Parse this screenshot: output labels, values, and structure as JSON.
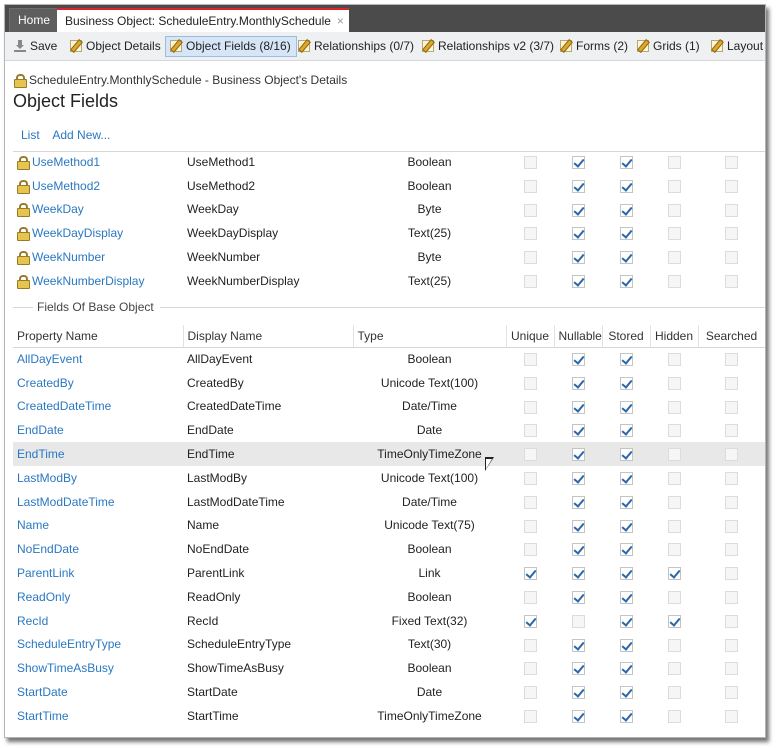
{
  "tabs": {
    "home": "Home",
    "active": "Business Object: ScheduleEntry.MonthlySchedule",
    "close": "×"
  },
  "toolbar": [
    {
      "label": "Save",
      "icon": "save-icon",
      "selected": false
    },
    {
      "label": "Object Details",
      "icon": "edit-icon",
      "selected": false
    },
    {
      "label": "Object Fields (8/16)",
      "icon": "edit-icon",
      "selected": true
    },
    {
      "label": "Relationships (0/7)",
      "icon": "edit-icon",
      "selected": false
    },
    {
      "label": "Relationships v2 (3/7)",
      "icon": "edit-icon",
      "selected": false
    },
    {
      "label": "Forms (2)",
      "icon": "edit-icon",
      "selected": false
    },
    {
      "label": "Grids (1)",
      "icon": "edit-icon",
      "selected": false
    },
    {
      "label": "Layout",
      "icon": "edit-icon",
      "selected": false
    }
  ],
  "header": {
    "breadcrumb": "ScheduleEntry.MonthlySchedule - Business Object's Details",
    "title": "Object Fields"
  },
  "sublinks": {
    "list": "List",
    "add_new": "Add New..."
  },
  "own_fields": [
    {
      "name": "UseMethod1",
      "display": "UseMethod1",
      "type": "Boolean",
      "checks": [
        false,
        true,
        true,
        false,
        false
      ]
    },
    {
      "name": "UseMethod2",
      "display": "UseMethod2",
      "type": "Boolean",
      "checks": [
        false,
        true,
        true,
        false,
        false
      ]
    },
    {
      "name": "WeekDay",
      "display": "WeekDay",
      "type": "Byte",
      "checks": [
        false,
        true,
        true,
        false,
        false
      ]
    },
    {
      "name": "WeekDayDisplay",
      "display": "WeekDayDisplay",
      "type": "Text(25)",
      "checks": [
        false,
        true,
        true,
        false,
        false
      ]
    },
    {
      "name": "WeekNumber",
      "display": "WeekNumber",
      "type": "Byte",
      "checks": [
        false,
        true,
        true,
        false,
        false
      ]
    },
    {
      "name": "WeekNumberDisplay",
      "display": "WeekNumberDisplay",
      "type": "Text(25)",
      "checks": [
        false,
        true,
        true,
        false,
        false
      ]
    }
  ],
  "base_group_label": "Fields Of Base Object",
  "columns": {
    "property": "Property Name",
    "display": "Display Name",
    "type": "Type",
    "unique": "Unique",
    "nullable": "Nullable",
    "stored": "Stored",
    "hidden": "Hidden",
    "searched": "Searched"
  },
  "base_fields": [
    {
      "name": "AllDayEvent",
      "display": "AllDayEvent",
      "type": "Boolean",
      "checks": [
        false,
        true,
        true,
        false,
        false
      ]
    },
    {
      "name": "CreatedBy",
      "display": "CreatedBy",
      "type": "Unicode Text(100)",
      "checks": [
        false,
        true,
        true,
        false,
        false
      ]
    },
    {
      "name": "CreatedDateTime",
      "display": "CreatedDateTime",
      "type": "Date/Time",
      "checks": [
        false,
        true,
        true,
        false,
        false
      ]
    },
    {
      "name": "EndDate",
      "display": "EndDate",
      "type": "Date",
      "checks": [
        false,
        true,
        true,
        false,
        false
      ]
    },
    {
      "name": "EndTime",
      "display": "EndTime",
      "type": "TimeOnlyTimeZone",
      "checks": [
        false,
        true,
        true,
        false,
        false
      ],
      "highlight": true
    },
    {
      "name": "LastModBy",
      "display": "LastModBy",
      "type": "Unicode Text(100)",
      "checks": [
        false,
        true,
        true,
        false,
        false
      ]
    },
    {
      "name": "LastModDateTime",
      "display": "LastModDateTime",
      "type": "Date/Time",
      "checks": [
        false,
        true,
        true,
        false,
        false
      ]
    },
    {
      "name": "Name",
      "display": "Name",
      "type": "Unicode Text(75)",
      "checks": [
        false,
        true,
        true,
        false,
        false
      ]
    },
    {
      "name": "NoEndDate",
      "display": "NoEndDate",
      "type": "Boolean",
      "checks": [
        false,
        true,
        true,
        false,
        false
      ]
    },
    {
      "name": "ParentLink",
      "display": "ParentLink",
      "type": "Link",
      "checks": [
        true,
        true,
        true,
        true,
        false
      ]
    },
    {
      "name": "ReadOnly",
      "display": "ReadOnly",
      "type": "Boolean",
      "checks": [
        false,
        true,
        true,
        false,
        false
      ]
    },
    {
      "name": "RecId",
      "display": "RecId",
      "type": "Fixed Text(32)",
      "checks": [
        true,
        false,
        true,
        true,
        false
      ]
    },
    {
      "name": "ScheduleEntryType",
      "display": "ScheduleEntryType",
      "type": "Text(30)",
      "checks": [
        false,
        true,
        true,
        false,
        false
      ]
    },
    {
      "name": "ShowTimeAsBusy",
      "display": "ShowTimeAsBusy",
      "type": "Boolean",
      "checks": [
        false,
        true,
        true,
        false,
        false
      ]
    },
    {
      "name": "StartDate",
      "display": "StartDate",
      "type": "Date",
      "checks": [
        false,
        true,
        true,
        false,
        false
      ]
    },
    {
      "name": "StartTime",
      "display": "StartTime",
      "type": "TimeOnlyTimeZone",
      "checks": [
        false,
        true,
        true,
        false,
        false
      ]
    }
  ]
}
